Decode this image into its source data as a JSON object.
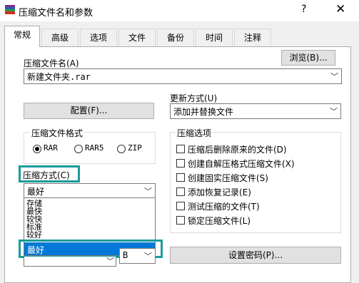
{
  "window": {
    "title": "压缩文件名和参数",
    "help": "?",
    "close": "✕"
  },
  "tabs": [
    "常规",
    "高级",
    "选项",
    "文件",
    "备份",
    "时间",
    "注释"
  ],
  "archive": {
    "label": "压缩文件名(A)",
    "value": "新建文件夹.rar",
    "browse_label": "浏览(B)..."
  },
  "update": {
    "label": "更新方式(U)",
    "value": "添加并替换文件"
  },
  "profile_button": "配置(F)...",
  "format": {
    "title": "压缩文件格式",
    "options": [
      "RAR",
      "RAR5",
      "ZIP"
    ],
    "selected": "RAR"
  },
  "method": {
    "label": "压缩方式(C)",
    "value": "最好",
    "options": [
      "存储",
      "最快",
      "较快",
      "标准",
      "较好",
      "最好"
    ],
    "selected": "最好"
  },
  "compression_options": {
    "title": "压缩选项",
    "items": [
      "压缩后删除原来的文件(D)",
      "创建自解压格式压缩文件(X)",
      "创建固实压缩文件(S)",
      "添加恢复记录(E)",
      "测试压缩的文件(T)",
      "锁定压缩文件(L)"
    ]
  },
  "split_value": "B",
  "password_button": "设置密码(P)..."
}
